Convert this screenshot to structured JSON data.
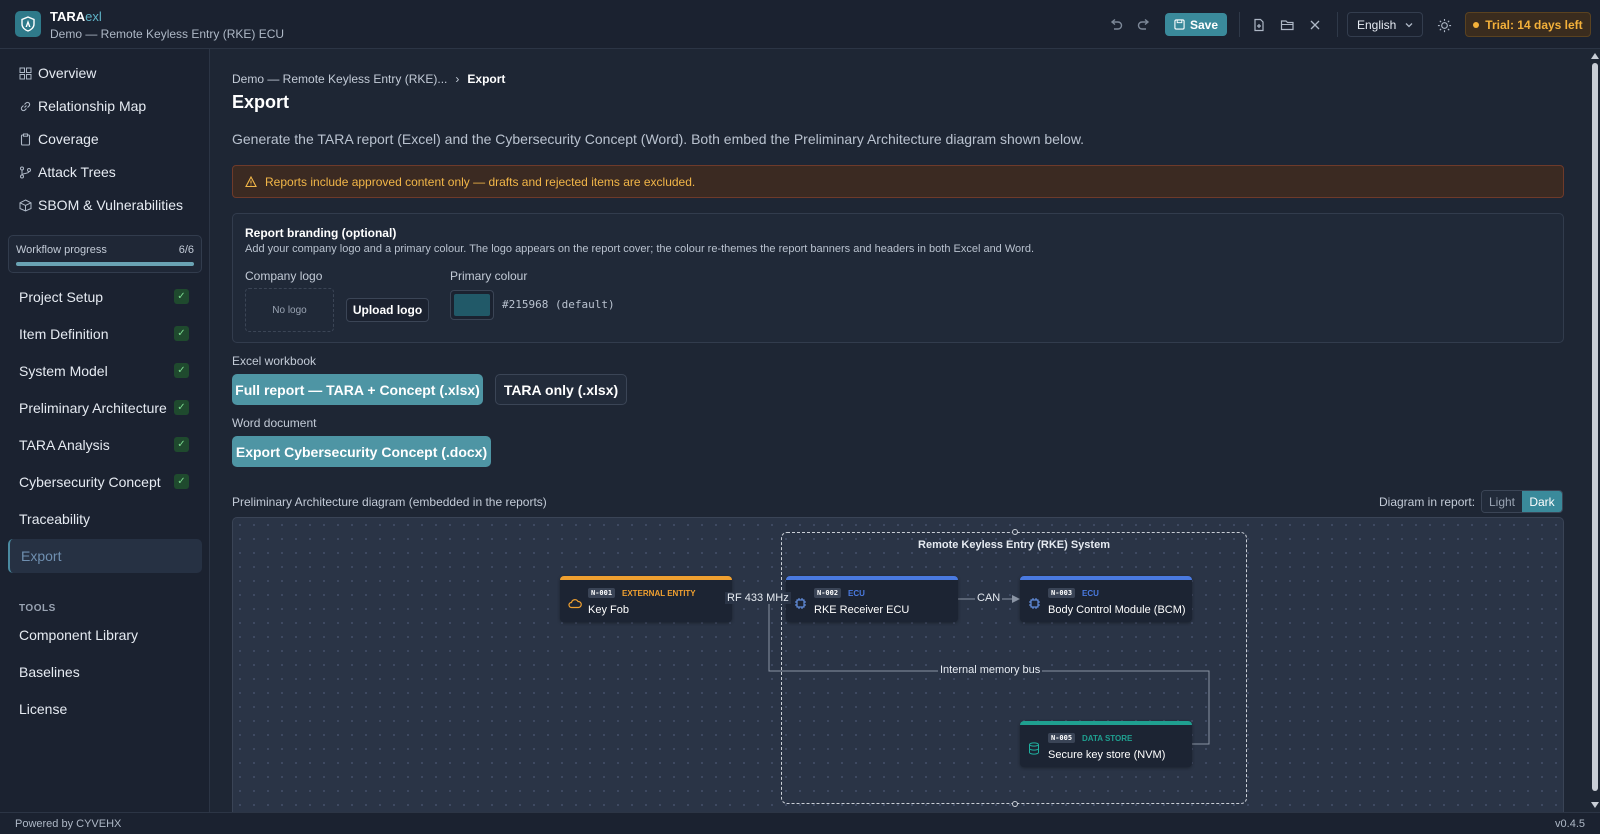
{
  "app": {
    "name_main": "TARA",
    "name_accent": "exl",
    "project": "Demo — Remote Keyless Entry (RKE) ECU"
  },
  "toolbar": {
    "save_label": "Save",
    "language": "English",
    "trial": "Trial: 14 days left"
  },
  "sidebar": {
    "top_items": [
      {
        "label": "Overview",
        "icon": "grid-icon"
      },
      {
        "label": "Relationship Map",
        "icon": "link-icon"
      },
      {
        "label": "Coverage",
        "icon": "clipboard-icon"
      },
      {
        "label": "Attack Trees",
        "icon": "branch-icon"
      },
      {
        "label": "SBOM & Vulnerabilities",
        "icon": "package-icon"
      }
    ],
    "workflow": {
      "label": "Workflow progress",
      "count": "6/6",
      "progress": 1.0
    },
    "steps": [
      {
        "label": "Project Setup",
        "done": true
      },
      {
        "label": "Item Definition",
        "done": true
      },
      {
        "label": "System Model",
        "done": true
      },
      {
        "label": "Preliminary Architecture",
        "done": true
      },
      {
        "label": "TARA Analysis",
        "done": true
      },
      {
        "label": "Cybersecurity Concept",
        "done": true
      },
      {
        "label": "Traceability",
        "done": false
      },
      {
        "label": "Export",
        "done": false,
        "active": true
      }
    ],
    "tools_label": "TOOLS",
    "tools": [
      "Component Library",
      "Baselines",
      "License"
    ]
  },
  "main": {
    "breadcrumb": {
      "parent": "Demo — Remote Keyless Entry (RKE)...",
      "sep": "›",
      "current": "Export"
    },
    "title": "Export",
    "intro": "Generate the TARA report (Excel) and the Cybersecurity Concept (Word). Both embed the Preliminary Architecture diagram shown below.",
    "warning": "Reports include approved content only — drafts and rejected items are excluded.",
    "branding": {
      "title": "Report branding (optional)",
      "desc": "Add your company logo and a primary colour. The logo appears on the report cover; the colour re-themes the report banners and headers in both Excel and Word.",
      "logo_label": "Company logo",
      "no_logo": "No logo",
      "upload_label": "Upload logo",
      "colour_label": "Primary colour",
      "colour_hex": "#215968",
      "colour_text": "#215968 (default)"
    },
    "excel": {
      "label": "Excel workbook",
      "full_btn": "Full report — TARA + Concept (.xlsx)",
      "tara_btn": "TARA only (.xlsx)"
    },
    "word": {
      "label": "Word document",
      "concept_btn": "Export Cybersecurity Concept (.docx)"
    },
    "diagram": {
      "label": "Preliminary Architecture diagram (embedded in the reports)",
      "theme_label": "Diagram in report:",
      "theme_light": "Light",
      "theme_dark": "Dark",
      "group_title": "Remote Keyless Entry (RKE) System",
      "nodes": [
        {
          "id": "N-001",
          "type": "EXTERNAL ENTITY",
          "name": "Key Fob",
          "color": "#f0a030"
        },
        {
          "id": "N-002",
          "type": "ECU",
          "name": "RKE Receiver ECU",
          "color": "#4a7ae0"
        },
        {
          "id": "N-003",
          "type": "ECU",
          "name": "Body Control Module (BCM)",
          "color": "#4a7ae0"
        },
        {
          "id": "N-005",
          "type": "DATA STORE",
          "name": "Secure key store (NVM)",
          "color": "#1fa090"
        }
      ],
      "edges": [
        {
          "label": "RF 433 MHz"
        },
        {
          "label": "CAN"
        },
        {
          "label": "Internal memory bus"
        }
      ]
    }
  },
  "footer": {
    "left": "Powered by CYVEHX",
    "right": "v0.4.5"
  },
  "colors": {
    "accent": "#3a8a9b",
    "warning": "#f2b648",
    "success": "#7bd88f"
  }
}
